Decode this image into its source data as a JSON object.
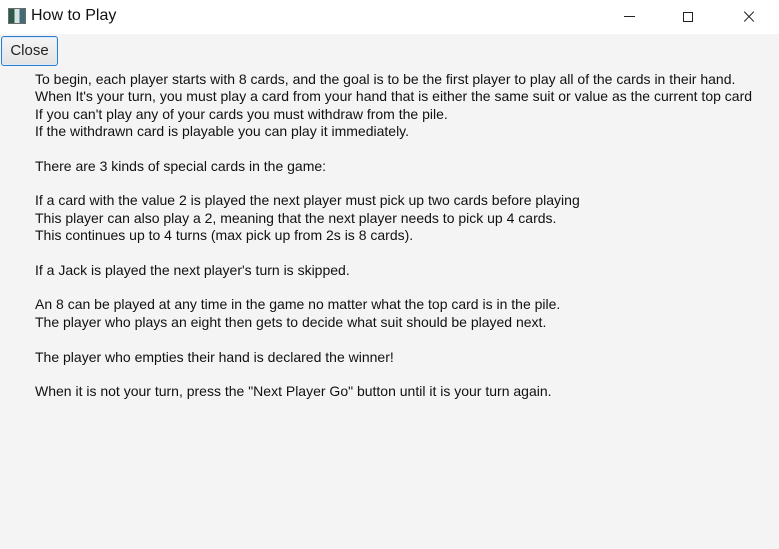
{
  "window": {
    "title": "How to Play",
    "controls": {
      "minimize_icon": "minimize-icon",
      "maximize_icon": "maximize-icon",
      "close_icon": "close-icon",
      "close_glyph": "×"
    }
  },
  "toolbar": {
    "close_label": "Close",
    "accent_color": "#2f7cc7"
  },
  "instructions": {
    "lines": [
      "To begin, each player starts with 8 cards, and the goal is to be the first player to play all of the cards in their hand.",
      "When It's your turn, you must play a card from your hand that is either the same suit or value as the current top card",
      "If you can't play any of your cards you must withdraw from the pile.",
      "If the withdrawn card is playable you can play it immediately.",
      "",
      "There are 3 kinds of special cards in the game:",
      "",
      "If a card with the value 2 is played the next player must pick up two cards before playing",
      "This player can also play a 2, meaning that the next player needs to pick up 4 cards.",
      "This continues up to 4 turns (max pick up from 2s is 8 cards).",
      "",
      "If a Jack is played the next player's turn is skipped.",
      "",
      "An 8 can be played at any time in the game no matter what the top card is in the pile.",
      "The player who plays an eight then gets to decide what suit should be played next.",
      "",
      "The player who empties their hand is declared the winner!",
      "",
      "When it is not your turn, press the \"Next Player Go\" button until it is your turn again."
    ]
  }
}
